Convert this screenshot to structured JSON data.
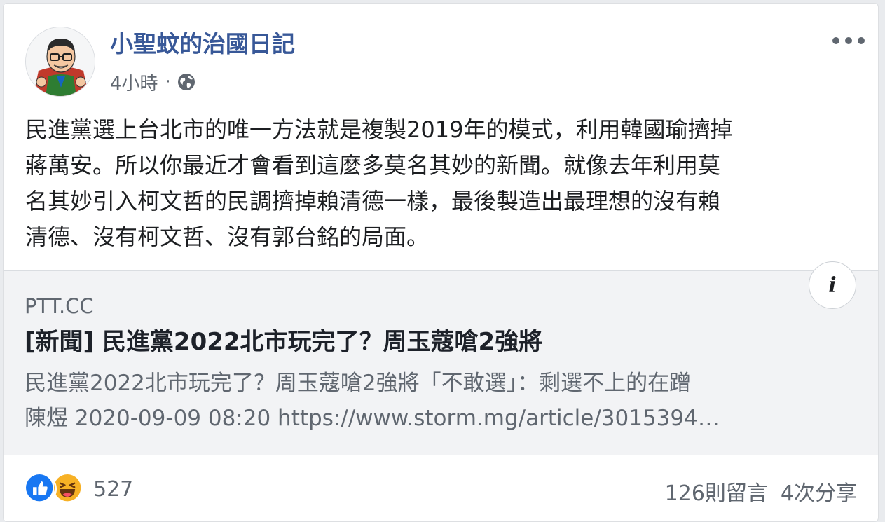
{
  "post": {
    "page_name": "小聖蚊的治國日記",
    "timestamp": "4小時",
    "separator": "·",
    "privacy_icon": "globe-icon",
    "more_icon": "more-horizontal-icon",
    "text_lines": [
      "民進黨選上台北市的唯一方法就是複製2019年的模式，利用韓國瑜擠掉",
      "蔣萬安。所以你最近才會看到這麼多莫名其妙的新聞。就像去年利用莫",
      "名其妙引入柯文哲的民調擠掉賴清德一樣，最後製造出最理想的沒有賴",
      "清德、沒有柯文哲、沒有郭台銘的局面。"
    ]
  },
  "link_preview": {
    "domain": "PTT.CC",
    "title": "[新聞] 民進黨2022北市玩完了？周玉蔻嗆2強將",
    "description_lines": [
      "民進黨2022北市玩完了？周玉蔻嗆2強將「不敢選」：剩選不上的在蹭",
      "陳煜 2020-09-09 08:20 https://www.storm.mg/article/3015394…"
    ],
    "info_label": "i"
  },
  "footer": {
    "reaction_icons": [
      "like-icon",
      "haha-icon"
    ],
    "reaction_count": "527",
    "comments": "126則留言",
    "shares": "4次分享"
  },
  "colors": {
    "page_name": "#385898",
    "like_blue": "#1877f2",
    "haha_yellow": "#f7b125",
    "text": "#1c1e21",
    "muted": "#606770",
    "link_bg": "#f2f3f5"
  }
}
